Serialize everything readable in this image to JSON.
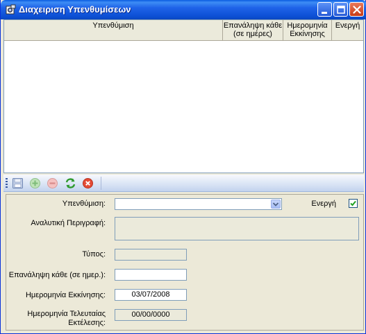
{
  "window": {
    "title": "Διαχειριση Υπενθυμίσεων",
    "app_icon": "app-gear-icon",
    "controls": [
      "minimize-icon",
      "maximize-icon",
      "close-icon"
    ]
  },
  "grid": {
    "columns": [
      {
        "label": "Υπενθύμιση"
      },
      {
        "label": "Επανάληψη κάθε (σε ημέρες)"
      },
      {
        "label": "Ημερομηνία Εκκίνησης"
      },
      {
        "label": "Ενεργή"
      }
    ],
    "rows": []
  },
  "toolbar": {
    "buttons": [
      {
        "name": "save-icon"
      },
      {
        "name": "add-icon"
      },
      {
        "name": "delete-icon"
      },
      {
        "name": "refresh-icon"
      },
      {
        "name": "cancel-icon"
      }
    ]
  },
  "form": {
    "reminder_label": "Υπενθύμιση:",
    "reminder_value": "",
    "active_label": "Ενεργή",
    "active_checked": true,
    "description_label": "Αναλυτική Περιγραφή:",
    "description_value": "",
    "type_label": "Τύπος:",
    "type_value": "",
    "repeat_label": "Επανάληψη κάθε (σε ημερ.):",
    "repeat_value": "",
    "start_date_label": "Ημερομηνία Εκκίνησης:",
    "start_date_value": "03/07/2008",
    "last_run_label": "Ημερομηνία Τελευταίας Εκτέλεσης:",
    "last_run_value": "00/00/0000"
  }
}
